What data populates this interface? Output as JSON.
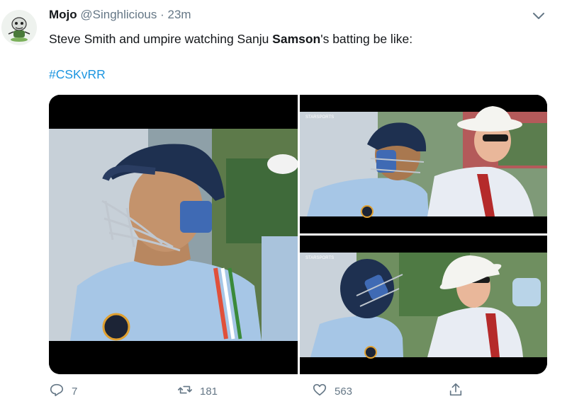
{
  "tweet": {
    "display_name": "Mojo",
    "handle": "@Singhlicious",
    "separator": "·",
    "time": "23m",
    "text_before": "Steve Smith and umpire watching Sanju ",
    "text_bold": "Samson",
    "text_after": "'s batting be like:",
    "hashtag": "#CSKvRR"
  },
  "media": {
    "images": [
      {
        "name": "batsman-closeup-image",
        "watermark": ""
      },
      {
        "name": "batsman-and-umpire-image-1",
        "watermark": "STARSPORTS"
      },
      {
        "name": "batsman-and-umpire-image-2",
        "watermark": "STARSPORTS"
      }
    ]
  },
  "actions": {
    "reply_count": "7",
    "retweet_count": "181",
    "like_count": "563"
  },
  "colors": {
    "accent": "#1b95e0",
    "muted": "#657786",
    "text": "#14171a"
  }
}
